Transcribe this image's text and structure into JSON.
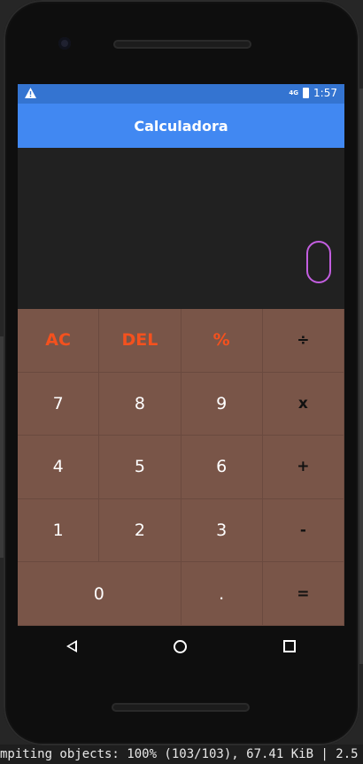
{
  "app": {
    "title": "Calculadora"
  },
  "statusbar": {
    "network": "4G",
    "time": "1:57"
  },
  "display": {
    "expression": "",
    "result": ""
  },
  "keys": [
    [
      {
        "label": "AC",
        "style": "orange",
        "name": "clear-button"
      },
      {
        "label": "DEL",
        "style": "orange",
        "name": "delete-button"
      },
      {
        "label": "%",
        "style": "orange",
        "name": "percent-button"
      },
      {
        "label": "÷",
        "style": "op",
        "name": "divide-button"
      }
    ],
    [
      {
        "label": "7",
        "style": "num",
        "name": "key-7-button"
      },
      {
        "label": "8",
        "style": "num",
        "name": "key-8-button"
      },
      {
        "label": "9",
        "style": "num",
        "name": "key-9-button"
      },
      {
        "label": "x",
        "style": "op",
        "name": "multiply-button"
      }
    ],
    [
      {
        "label": "4",
        "style": "num",
        "name": "key-4-button"
      },
      {
        "label": "5",
        "style": "num",
        "name": "key-5-button"
      },
      {
        "label": "6",
        "style": "num",
        "name": "key-6-button"
      },
      {
        "label": "+",
        "style": "op",
        "name": "plus-button"
      }
    ],
    [
      {
        "label": "1",
        "style": "num",
        "name": "key-1-button"
      },
      {
        "label": "2",
        "style": "num",
        "name": "key-2-button"
      },
      {
        "label": "3",
        "style": "num",
        "name": "key-3-button"
      },
      {
        "label": "-",
        "style": "op",
        "name": "minus-button"
      }
    ],
    [
      {
        "label": "0",
        "style": "num",
        "name": "key-0-button",
        "span": 2
      },
      {
        "label": ".",
        "style": "num",
        "name": "decimal-button"
      },
      {
        "label": "=",
        "style": "op",
        "name": "equals-button"
      }
    ]
  ],
  "colors": {
    "appbar": "#4188f2",
    "statusbar": "#3474d1",
    "display_bg": "#212121",
    "keypad_bg": "#795548",
    "accent_orange": "#f4511e",
    "cursor": "#c35ee0"
  },
  "backdrop": {
    "terminal_line": "mpiting objects: 100% (103/103), 67.41 KiB | 2.5"
  },
  "icons": [
    "warning-icon",
    "battery-charging-icon",
    "back-icon",
    "home-icon",
    "recent-apps-icon"
  ]
}
